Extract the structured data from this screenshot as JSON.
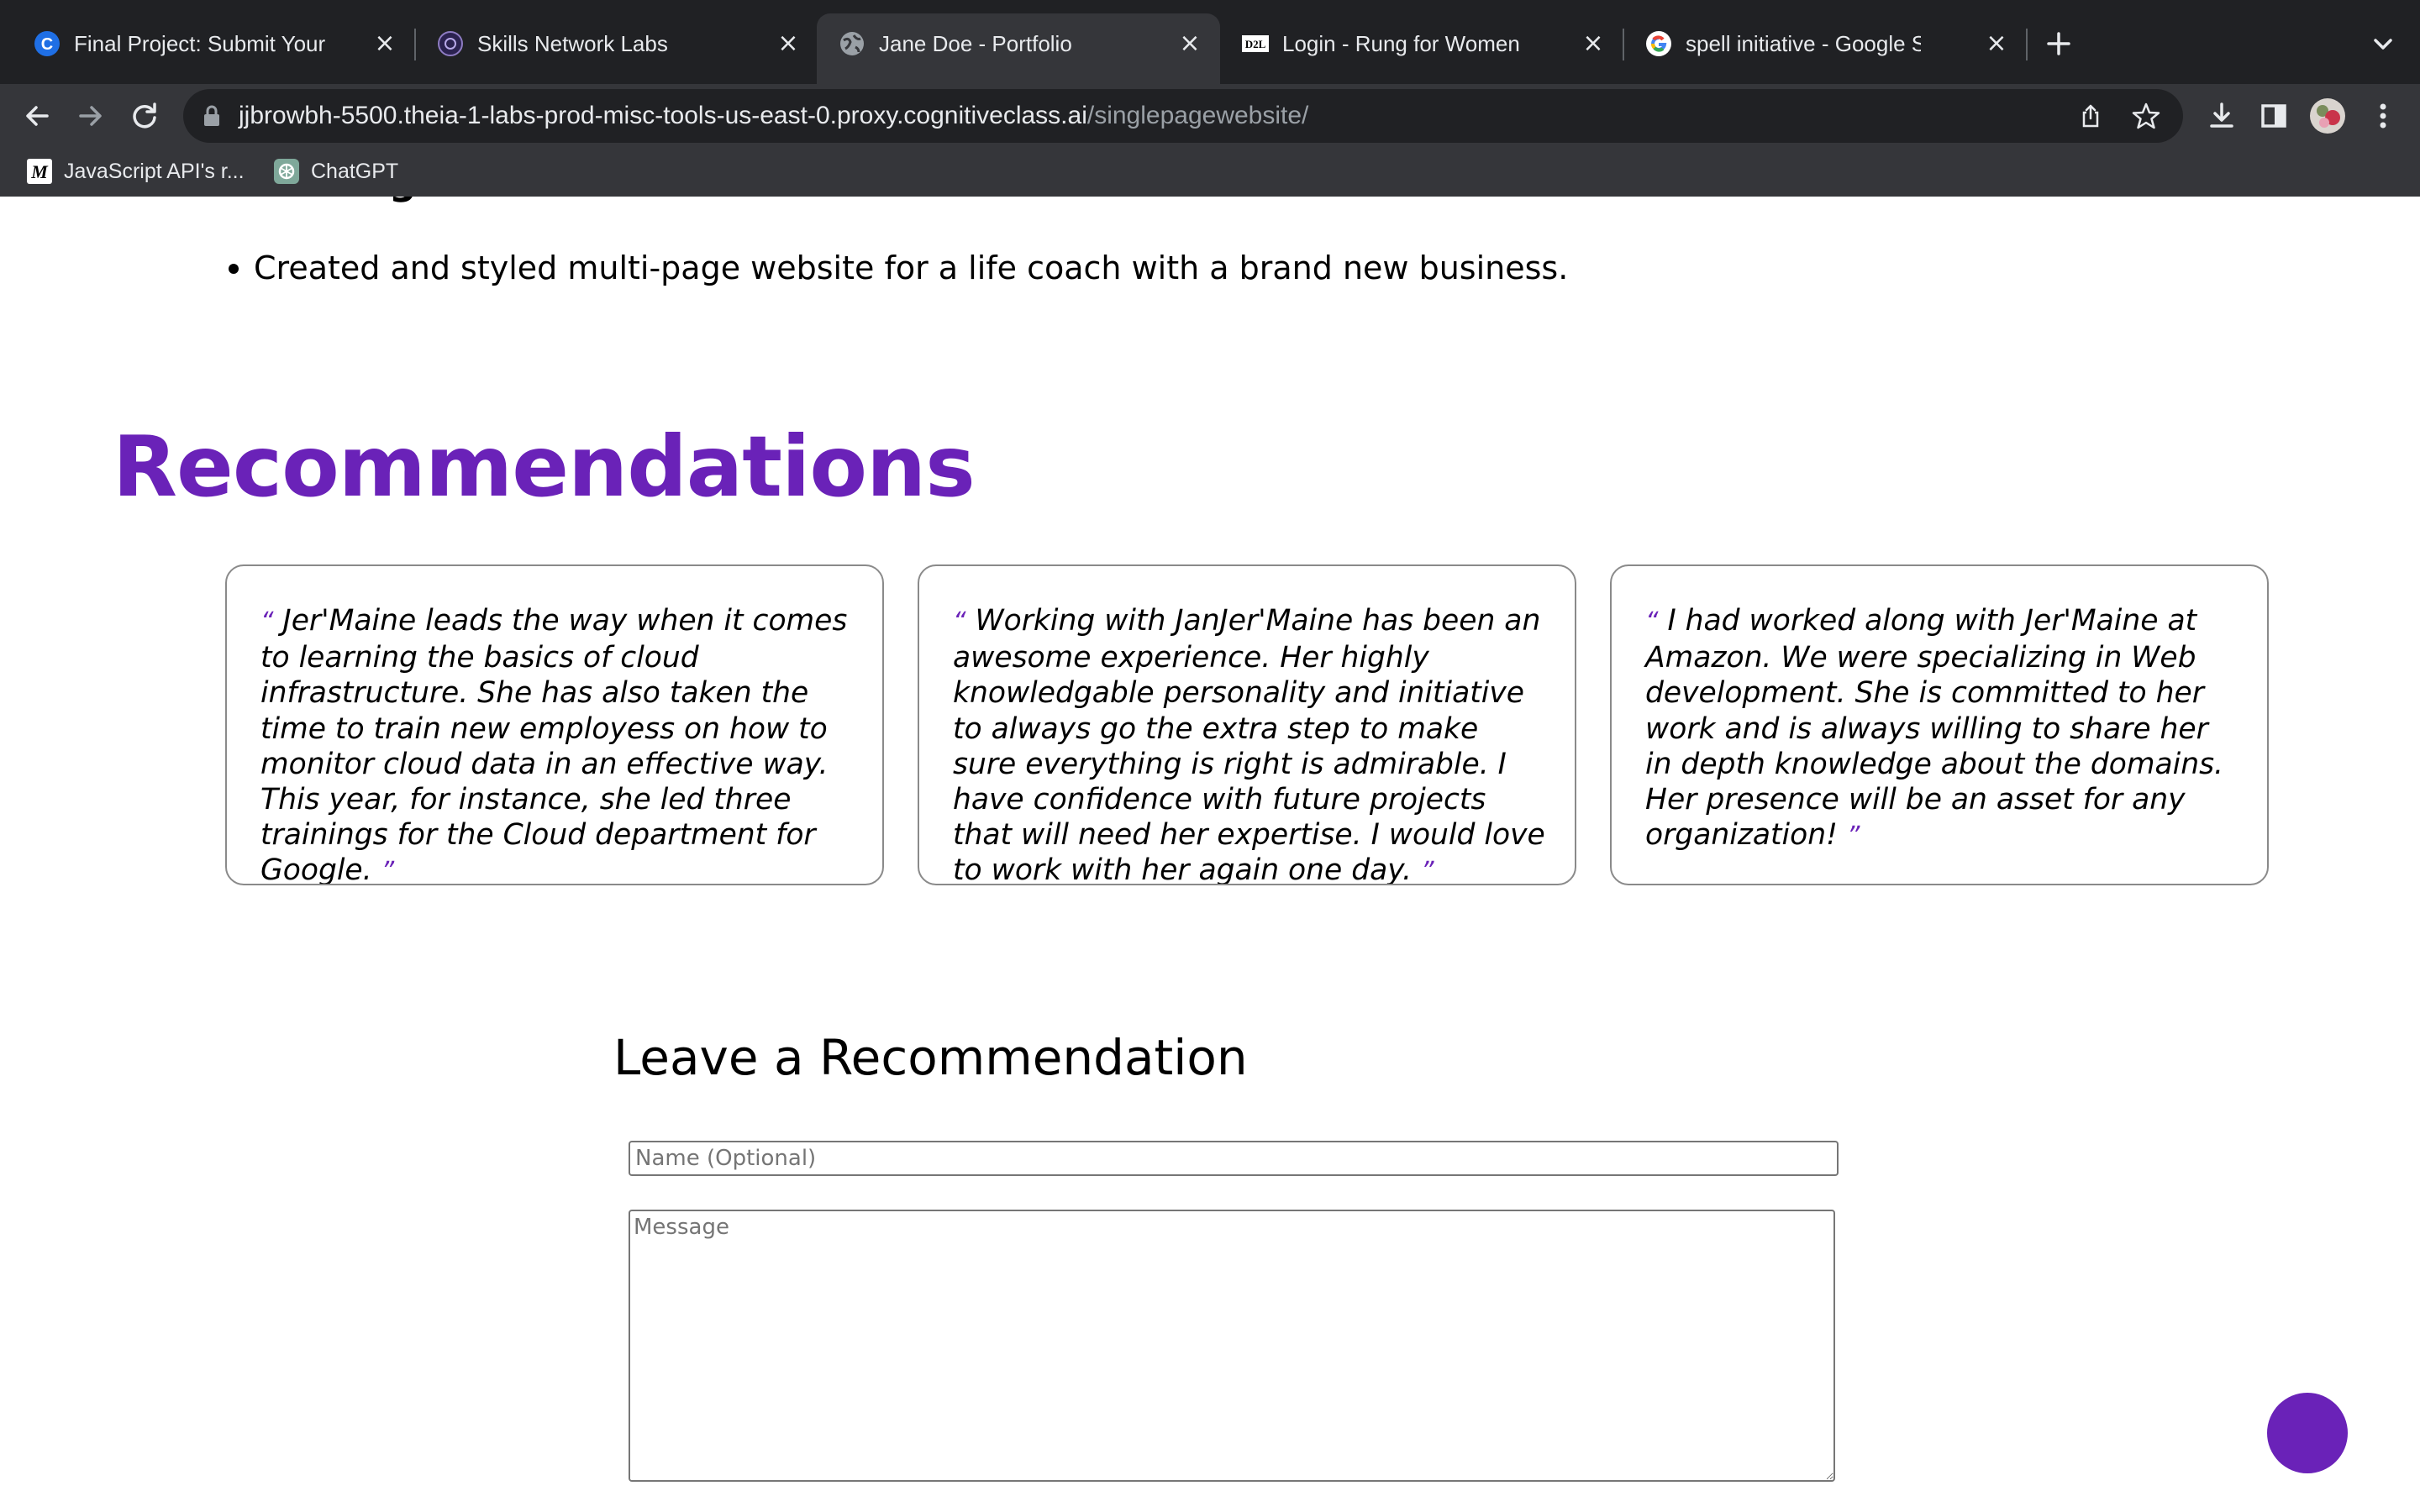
{
  "browser": {
    "tabs": [
      {
        "title": "Final Project: Submit Your Wor",
        "favicon": "coursera-c-icon",
        "active": false
      },
      {
        "title": "Skills Network Labs",
        "favicon": "skills-network-icon",
        "active": false
      },
      {
        "title": "Jane Doe - Portfolio",
        "favicon": "globe-icon",
        "active": true
      },
      {
        "title": "Login - Rung for Women",
        "favicon": "d2l-icon",
        "active": false
      },
      {
        "title": "spell initiative - Google Search",
        "favicon": "google-icon",
        "active": false
      }
    ],
    "d2l_badge": "D2L",
    "url_host": "jjbrowbh-5500.theia-1-labs-prod-misc-tools-us-east-0.proxy.cognitiveclass.ai",
    "url_path": "/singlepagewebsite/",
    "bookmarks": [
      {
        "label": "JavaScript API's r...",
        "icon": "m-letter-icon",
        "badge": "M"
      },
      {
        "label": "ChatGPT",
        "icon": "chatgpt-icon"
      }
    ]
  },
  "page": {
    "cut_heading": "Coaching Website",
    "bullets": [
      "Created and styled multi-page website for a life coach with a brand new business."
    ],
    "recommendations_title": "Recommendations",
    "open_quote": "“",
    "close_quote": "”",
    "recommendations": [
      {
        "text": "Jer'Maine leads the way when it comes to learning the basics of cloud infrastructure. She has also taken the time to train new employess on how to monitor cloud data in an effective way. This year, for instance, she led three trainings for the Cloud department for Google."
      },
      {
        "text": "Working with JanJer'Maine has been an awesome experience. Her highly knowledgable personality and initiative to always go the extra step to make sure everything is right is admirable. I have confidence with future projects that will need her expertise. I would love to work with her again one day."
      },
      {
        "text": "I had worked along with Jer'Maine at Amazon. We were specializing in Web development. She is committed to her work and is always willing to share her in depth knowledge about the domains. Her presence will be an asset for any organization!"
      }
    ],
    "form": {
      "title": "Leave a Recommendation",
      "name_placeholder": "Name (Optional)",
      "message_placeholder": "Message"
    }
  },
  "colors": {
    "accent": "#6a22b8",
    "chrome_dark": "#202124",
    "chrome_mid": "#35363a"
  }
}
